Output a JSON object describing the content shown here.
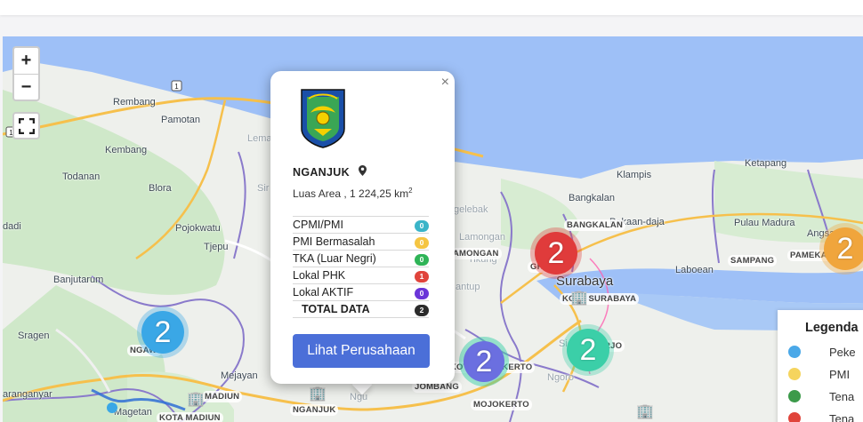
{
  "colors": {
    "sea": "#9ec0f7",
    "land": "#eef0ec",
    "forest": "#c9e6c5",
    "highway": "#f6c04c",
    "border": "#8a7acb",
    "cluster_blue": "#3aa7e6",
    "cluster_red": "#e03b3b",
    "cluster_orange": "#f0a53c",
    "cluster_teal": "#3bcfa8",
    "cluster_purple": "#6b6fe0",
    "button": "#4b6fd8"
  },
  "map": {
    "zoom_in": "+",
    "zoom_out": "−",
    "fullscreen_icon": "fullscreen-icon",
    "places": [
      "Rembang",
      "Pamotan",
      "Kembang",
      "Todanan",
      "Blora",
      "Pojokwatu",
      "Tjepu",
      "dadi",
      "Banjutarum",
      "Sragen",
      "aranganyar",
      "Magetan",
      "Mejayan",
      "Lema",
      "Sir",
      "Ketapang",
      "Klampis",
      "Bangkalan",
      "Pakaan-daja",
      "Pulau Madura",
      "Angsana",
      "Laboean",
      "Tikung",
      "gelebak",
      "Lamongan",
      "antup",
      "Surabaya",
      "Sid",
      "Ngoro",
      "Ngu"
    ],
    "badges": [
      "NGAWI",
      "MADIUN",
      "KOTA MADIUN",
      "NGANJUK",
      "JOMBANG",
      "KOTA MOJOKERTO",
      "MOJOKERTO",
      "SIDOARJO",
      "KOTA SURABAYA",
      "GRESIK",
      "BANGKALAN",
      "SAMPANG",
      "PAMEKASAN",
      "AMONGAN"
    ],
    "clusters": [
      {
        "label": "2",
        "color": "blue"
      },
      {
        "label": "2",
        "color": "red"
      },
      {
        "label": "2",
        "color": "orange"
      },
      {
        "label": "2",
        "color": "teal"
      },
      {
        "label": "2",
        "color": "purple"
      }
    ],
    "highway_shields": [
      "1",
      "1"
    ]
  },
  "popup": {
    "close": "×",
    "region": "NGANJUK",
    "area_text": "Luas Area , 1 224,25  km",
    "area_unit_sup": "2",
    "stats": [
      {
        "label": "CPMI/PMI",
        "value": "0",
        "color": "#3ab4c8"
      },
      {
        "label": "PMI Bermasalah",
        "value": "0",
        "color": "#f5c542"
      },
      {
        "label": "TKA (Luar Negri)",
        "value": "0",
        "color": "#2fb457"
      },
      {
        "label": "Lokal PHK",
        "value": "1",
        "color": "#e0443b"
      },
      {
        "label": "Lokal AKTIF",
        "value": "0",
        "color": "#6a35d8"
      }
    ],
    "total": {
      "label": "TOTAL DATA",
      "value": "2",
      "color": "#2b2b2b"
    },
    "button_label": "Lihat Perusahaan"
  },
  "legend": {
    "title": "Legenda",
    "items": [
      {
        "label": "Peke",
        "color": "#4aa8e8"
      },
      {
        "label": "PMI",
        "color": "#f5d45e"
      },
      {
        "label": "Tena",
        "color": "#3c9a4a"
      },
      {
        "label": "Tena",
        "color": "#e0443b"
      }
    ]
  }
}
